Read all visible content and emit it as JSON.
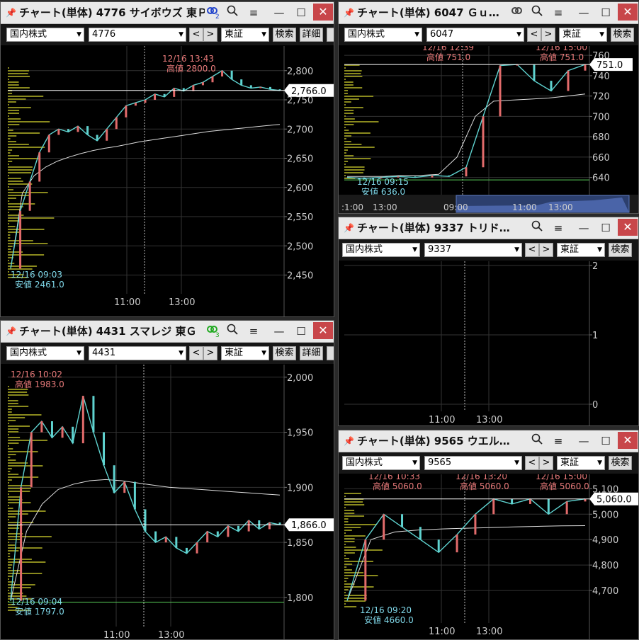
{
  "common": {
    "market_label": "国内株式",
    "exchange_label": "東証",
    "search_label": "検索",
    "detail_label": "詳細",
    "prev": "<",
    "next": ">"
  },
  "windows": [
    {
      "title": "チャート(単体) 4776 サイボウズ 東Ｐ",
      "code": "4776",
      "link_badge": "2",
      "link_color": "#2244cc",
      "current_price": "2,766.0",
      "chart_data": {
        "type": "line",
        "ylim": [
          2430,
          2830
        ],
        "yticks": [
          "2,800",
          "2,750",
          "2,700",
          "2,650",
          "2,600",
          "2,550",
          "2,500",
          "2,450"
        ],
        "xticks": [
          "11:00",
          "13:00"
        ],
        "high_annotation": [
          "12/16 13:43",
          "高値 2800.0"
        ],
        "low_annotation": [
          "12/16 09:03",
          "安値 2461.0"
        ],
        "price_series": [
          2461,
          2560,
          2610,
          2660,
          2690,
          2700,
          2695,
          2705,
          2690,
          2680,
          2700,
          2720,
          2740,
          2745,
          2750,
          2760,
          2755,
          2770,
          2765,
          2775,
          2780,
          2790,
          2800,
          2785,
          2775,
          2770,
          2772,
          2768,
          2766
        ],
        "vwap_series": [
          2461,
          2590,
          2620,
          2635,
          2645,
          2652,
          2658,
          2663,
          2667,
          2670,
          2674,
          2678,
          2681,
          2684,
          2687,
          2690,
          2693,
          2696,
          2698,
          2700,
          2702,
          2704,
          2706,
          2708
        ]
      }
    },
    {
      "title": "チャート(単体) 6047 Ｇｕ…",
      "code": "6047",
      "current_price": "751.0",
      "chart_data": {
        "type": "line",
        "ylim": [
          630,
          765
        ],
        "yticks": [
          "760",
          "740",
          "720",
          "700",
          "680",
          "660",
          "640"
        ],
        "xticks": [
          "11:00",
          "13:00"
        ],
        "high_annotation_left": [
          "12/16 12:39",
          "高値 751.0"
        ],
        "high_annotation_right": [
          "12/16 15:00",
          "高値 751.0"
        ],
        "low_annotation": [
          "12/16 09:15",
          "安値 636.0"
        ],
        "price_series": [
          640,
          639,
          640,
          641,
          640,
          642,
          641,
          650,
          700,
          750,
          751,
          735,
          725,
          745,
          751
        ],
        "vwap_series": [
          641,
          641,
          641,
          642,
          642,
          643,
          660,
          700,
          715,
          716,
          717,
          718,
          720,
          722
        ]
      },
      "navigator": {
        "labels": [
          ":1:00",
          "13:00",
          "09:00",
          "11:00",
          "13:00"
        ]
      }
    },
    {
      "title": "チャート(単体) 9337 トリド…",
      "code": "9337",
      "chart_data": {
        "type": "line",
        "ylim": [
          0,
          2
        ],
        "yticks": [
          "2",
          "1",
          "0"
        ],
        "xticks": [
          "11:00",
          "13:00"
        ],
        "series": []
      }
    },
    {
      "title": "チャート(単体) 4431 スマレジ 東Ｇ",
      "code": "4431",
      "link_badge": "3",
      "link_color": "#22aa22",
      "current_price": "1,866.0",
      "chart_data": {
        "type": "line",
        "ylim": [
          1780,
          2005
        ],
        "yticks": [
          "2,000",
          "1,950",
          "1,900",
          "1,850",
          "1,800"
        ],
        "xticks": [
          "11:00",
          "13:00"
        ],
        "high_annotation": [
          "12/16 10:02",
          "高値 1983.0"
        ],
        "low_annotation": [
          "12/16 09:04",
          "安値 1797.0"
        ],
        "price_series": [
          1797,
          1900,
          1950,
          1960,
          1945,
          1955,
          1940,
          1983,
          1950,
          1920,
          1895,
          1905,
          1880,
          1860,
          1850,
          1855,
          1845,
          1840,
          1850,
          1860,
          1855,
          1865,
          1860,
          1870,
          1862,
          1868,
          1866
        ],
        "vwap_series": [
          1797,
          1860,
          1885,
          1898,
          1903,
          1906,
          1907,
          1906,
          1904,
          1902,
          1900,
          1899,
          1898,
          1897,
          1896,
          1895,
          1894,
          1893
        ]
      }
    },
    {
      "title": "チャート(単体) 9565 ウエル…",
      "code": "9565",
      "current_price": "5,060.0",
      "chart_data": {
        "type": "line",
        "ylim": [
          4600,
          5140
        ],
        "yticks": [
          "5,100",
          "5,000",
          "4,900",
          "4,800",
          "4,700"
        ],
        "xticks": [
          "11:00",
          "13:00"
        ],
        "high_annotation_1": [
          "12/16 10:33",
          "高値 5060.0"
        ],
        "high_annotation_2": [
          "12/16 13:20",
          "高値 5060.0"
        ],
        "high_annotation_3": [
          "12/16 15:00",
          "高値 5060.0"
        ],
        "low_annotation": [
          "12/16 09:20",
          "安値 4660.0"
        ],
        "price_series": [
          4660,
          4900,
          5000,
          4950,
          4900,
          4850,
          4920,
          5000,
          5060,
          5040,
          5060,
          5000,
          5050,
          5060
        ],
        "vwap_series": [
          4660,
          4900,
          4930,
          4938,
          4942,
          4945,
          4947,
          4950,
          4952,
          4954,
          4955
        ]
      }
    }
  ]
}
